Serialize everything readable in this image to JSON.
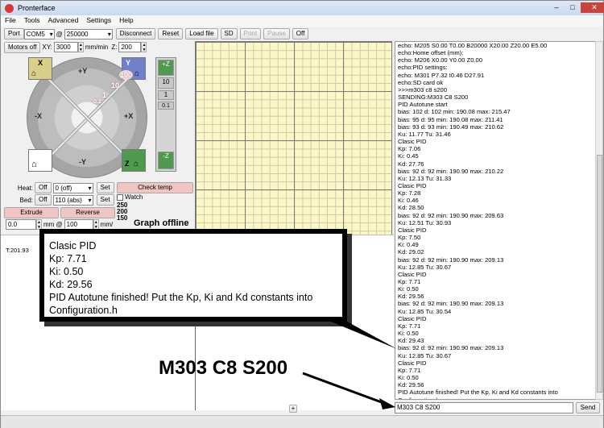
{
  "window": {
    "title": "Pronterface",
    "controls": [
      "–",
      "□",
      "✕"
    ]
  },
  "menu": [
    "File",
    "Tools",
    "Advanced",
    "Settings",
    "Help"
  ],
  "toolbar": {
    "port_label": "Port",
    "port_value": "COM5",
    "at": "@",
    "baud_value": "250000",
    "disconnect": "Disconnect",
    "reset": "Reset",
    "load_file": "Load file",
    "sd": "SD",
    "print": "Print",
    "pause": "Pause",
    "off": "Off"
  },
  "row2": {
    "motors_off": "Motors off",
    "xy_label": "XY:",
    "xy_value": "3000",
    "unit": "mm/min",
    "z_label": "Z:",
    "z_value": "200"
  },
  "jog": {
    "x_home": "X",
    "y_home": "Y",
    "z_home": "Z",
    "plus_y": "+Y",
    "minus_y": "-Y",
    "minus_x": "-X",
    "plus_x": "+X",
    "step_100": "100",
    "step_10": "10",
    "step_1": "1",
    "step_01": "0.1",
    "plus_z": "+Z",
    "minus_z": "-Z",
    "z_10": "10",
    "z_1": "1",
    "z_01": "0.1"
  },
  "temps": {
    "heat_label": "Heat:",
    "heat_off": "Off",
    "heat_value": "0 (off)",
    "heat_set": "Set",
    "bed_label": "Bed:",
    "bed_off": "Off",
    "bed_value": "110 (abs)",
    "bed_set": "Set",
    "check_temp": "Check temp",
    "watch": "Watch",
    "extrude": "Extrude",
    "reverse": "Reverse",
    "e_len": "0.0",
    "e_unit": "mm @",
    "e_speed": "100",
    "e_speed_unit": "mm/",
    "graph_ticks": [
      "250",
      "200",
      "150"
    ],
    "graph_offline": "Graph offline",
    "temp_readout": "T:201.93"
  },
  "log_lines": [
    "echo:  M205 S0.00 T0.00 B20000 X20.00 Z20.00 E5.00",
    "echo:Home offset (mm):",
    "echo:  M206 X0.00 Y0.00 Z0.00",
    "echo:PID settings:",
    "echo:   M301 P7.32 I0.46 D27.91",
    "echo:SD card ok",
    ">>>m303 c8 s200",
    "SENDING:M303 C8 S200",
    "PID Autotune start",
    " bias: 102 d: 102 min: 190.08 max: 215.47",
    " bias: 95 d: 95 min: 190.08 max: 211.41",
    " bias: 93 d: 93 min: 190.49 max: 210.62",
    " Ku: 11.77 Tu: 31.46",
    " Clasic PID",
    " Kp: 7.06",
    " Ki: 0.45",
    " Kd: 27.76",
    " bias: 92 d: 92 min: 190.90 max: 210.22",
    " Ku: 12.13 Tu: 31.33",
    " Clasic PID",
    " Kp: 7.28",
    " Ki: 0.46",
    " Kd: 28.50",
    " bias: 92 d: 92 min: 190.90 max: 209.63",
    " Ku: 12.51 Tu: 30.93",
    " Clasic PID",
    " Kp: 7.50",
    " Ki: 0.49",
    " Kd: 29.02",
    " bias: 92 d: 92 min: 190.90 max: 209.13",
    " Ku: 12.85 Tu: 30.67",
    " Clasic PID",
    " Kp: 7.71",
    " Ki: 0.50",
    " Kd: 29.56",
    " bias: 92 d: 92 min: 190.90 max: 209.13",
    " Ku: 12.85 Tu: 30.54",
    " Clasic PID",
    " Kp: 7.71",
    " Ki: 0.50",
    " Kd: 29.43",
    " bias: 92 d: 92 min: 190.90 max: 209.13",
    " Ku: 12.85 Tu: 30.67",
    " Clasic PID",
    " Kp: 7.71",
    " Ki: 0.50",
    " Kd: 29.56",
    "PID Autotune finished! Put the Kp, Ki and Kd constants into",
    "Configuration.h"
  ],
  "command": {
    "value": "M303 C8 S200",
    "send": "Send"
  },
  "callout_lines": [
    "Clasic PID",
    "Kp: 7.71",
    "Ki: 0.50",
    "Kd: 29.56",
    "PID Autotune finished! Put the Kp, Ki and Kd constants into",
    "Configuration.h"
  ],
  "annotation_command": "M303 C8 S200",
  "plus_button": "+",
  "colors": {
    "grid_bg": "#fbf7c7",
    "jog_blue": "#6f7fc9",
    "jog_yellow": "#d8cf8a",
    "jog_green": "#4f9a4f",
    "close_red": "#c9453b"
  }
}
